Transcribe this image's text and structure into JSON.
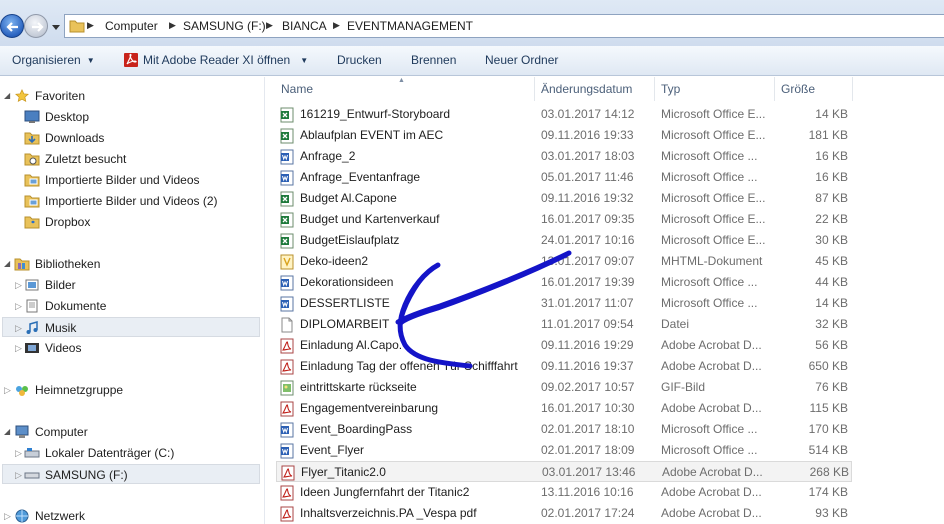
{
  "address": {
    "crumbs": [
      "Computer",
      "SAMSUNG (F:)",
      "BIANCA",
      "EVENTMANAGEMENT"
    ]
  },
  "toolbar": {
    "organize": "Organisieren",
    "open_with": "Mit Adobe Reader XI öffnen",
    "print": "Drucken",
    "burn": "Brennen",
    "new_folder": "Neuer Ordner"
  },
  "nav": {
    "favorites": "Favoriten",
    "fav_items": [
      "Desktop",
      "Downloads",
      "Zuletzt besucht",
      "Importierte Bilder und Videos",
      "Importierte Bilder und Videos (2)",
      "Dropbox"
    ],
    "libraries": "Bibliotheken",
    "lib_items": [
      "Bilder",
      "Dokumente",
      "Musik",
      "Videos"
    ],
    "homegroup": "Heimnetzgruppe",
    "computer": "Computer",
    "drives": [
      "Lokaler Datenträger (C:)",
      "SAMSUNG (F:)"
    ],
    "network": "Netzwerk"
  },
  "columns": {
    "name": "Name",
    "date": "Änderungsdatum",
    "type": "Typ",
    "size": "Größe"
  },
  "files": [
    {
      "name": "161219_Entwurf-Storyboard",
      "date": "03.01.2017 14:12",
      "type": "Microsoft Office E...",
      "size": "14 KB",
      "icon": "excel-icon"
    },
    {
      "name": "Ablaufplan EVENT im AEC",
      "date": "09.11.2016 19:33",
      "type": "Microsoft Office E...",
      "size": "181 KB",
      "icon": "excel-icon"
    },
    {
      "name": "Anfrage_2",
      "date": "03.01.2017 18:03",
      "type": "Microsoft Office ...",
      "size": "16 KB",
      "icon": "word-icon"
    },
    {
      "name": "Anfrage_Eventanfrage",
      "date": "05.01.2017 11:46",
      "type": "Microsoft Office ...",
      "size": "16 KB",
      "icon": "word-icon"
    },
    {
      "name": "Budget Al.Capone",
      "date": "09.11.2016 19:32",
      "type": "Microsoft Office E...",
      "size": "87 KB",
      "icon": "excel-icon"
    },
    {
      "name": "Budget und Kartenverkauf",
      "date": "16.01.2017 09:35",
      "type": "Microsoft Office E...",
      "size": "22 KB",
      "icon": "excel-icon"
    },
    {
      "name": "BudgetEislaufplatz",
      "date": "24.01.2017 10:16",
      "type": "Microsoft Office E...",
      "size": "30 KB",
      "icon": "excel-icon"
    },
    {
      "name": "Deko-ideen2",
      "date": "13.01.2017 09:07",
      "type": "MHTML-Dokument",
      "size": "45 KB",
      "icon": "mhtml-icon"
    },
    {
      "name": "Dekorationsideen",
      "date": "16.01.2017 19:39",
      "type": "Microsoft Office ...",
      "size": "44 KB",
      "icon": "word-icon"
    },
    {
      "name": "DESSERTLISTE",
      "date": "31.01.2017 11:07",
      "type": "Microsoft Office ...",
      "size": "14 KB",
      "icon": "word-icon"
    },
    {
      "name": "DIPLOMARBEIT",
      "date": "11.01.2017 09:54",
      "type": "Datei",
      "size": "32 KB",
      "icon": "blank-file-icon"
    },
    {
      "name": "Einladung Al.Capo.",
      "date": "09.11.2016 19:29",
      "type": "Adobe Acrobat D...",
      "size": "56 KB",
      "icon": "pdf-icon"
    },
    {
      "name": "Einladung Tag der offenen Tür Schifffahrt",
      "date": "09.11.2016 19:37",
      "type": "Adobe Acrobat D...",
      "size": "650 KB",
      "icon": "pdf-icon"
    },
    {
      "name": "eintrittskarte rückseite",
      "date": "09.02.2017 10:57",
      "type": "GIF-Bild",
      "size": "76 KB",
      "icon": "gif-icon"
    },
    {
      "name": "Engagementvereinbarung",
      "date": "16.01.2017 10:30",
      "type": "Adobe Acrobat D...",
      "size": "115 KB",
      "icon": "pdf-icon"
    },
    {
      "name": "Event_BoardingPass",
      "date": "02.01.2017 18:10",
      "type": "Microsoft Office ...",
      "size": "170 KB",
      "icon": "word-icon"
    },
    {
      "name": "Event_Flyer",
      "date": "02.01.2017 18:09",
      "type": "Microsoft Office ...",
      "size": "514 KB",
      "icon": "word-icon"
    },
    {
      "name": "Flyer_Titanic2.0",
      "date": "03.01.2017 13:46",
      "type": "Adobe Acrobat D...",
      "size": "268 KB",
      "icon": "pdf-icon",
      "selected": true
    },
    {
      "name": "Ideen Jungfernfahrt der Titanic2",
      "date": "13.11.2016 10:16",
      "type": "Adobe Acrobat D...",
      "size": "174 KB",
      "icon": "pdf-icon"
    },
    {
      "name": "Inhaltsverzeichnis.PA _Vespa pdf",
      "date": "02.01.2017 17:24",
      "type": "Adobe Acrobat D...",
      "size": "93 KB",
      "icon": "pdf-icon"
    }
  ],
  "colors": {
    "annotation_stroke": "#1414c8",
    "excel": "#1f7a3c",
    "word": "#2b5fb4",
    "pdf": "#c0201a"
  }
}
